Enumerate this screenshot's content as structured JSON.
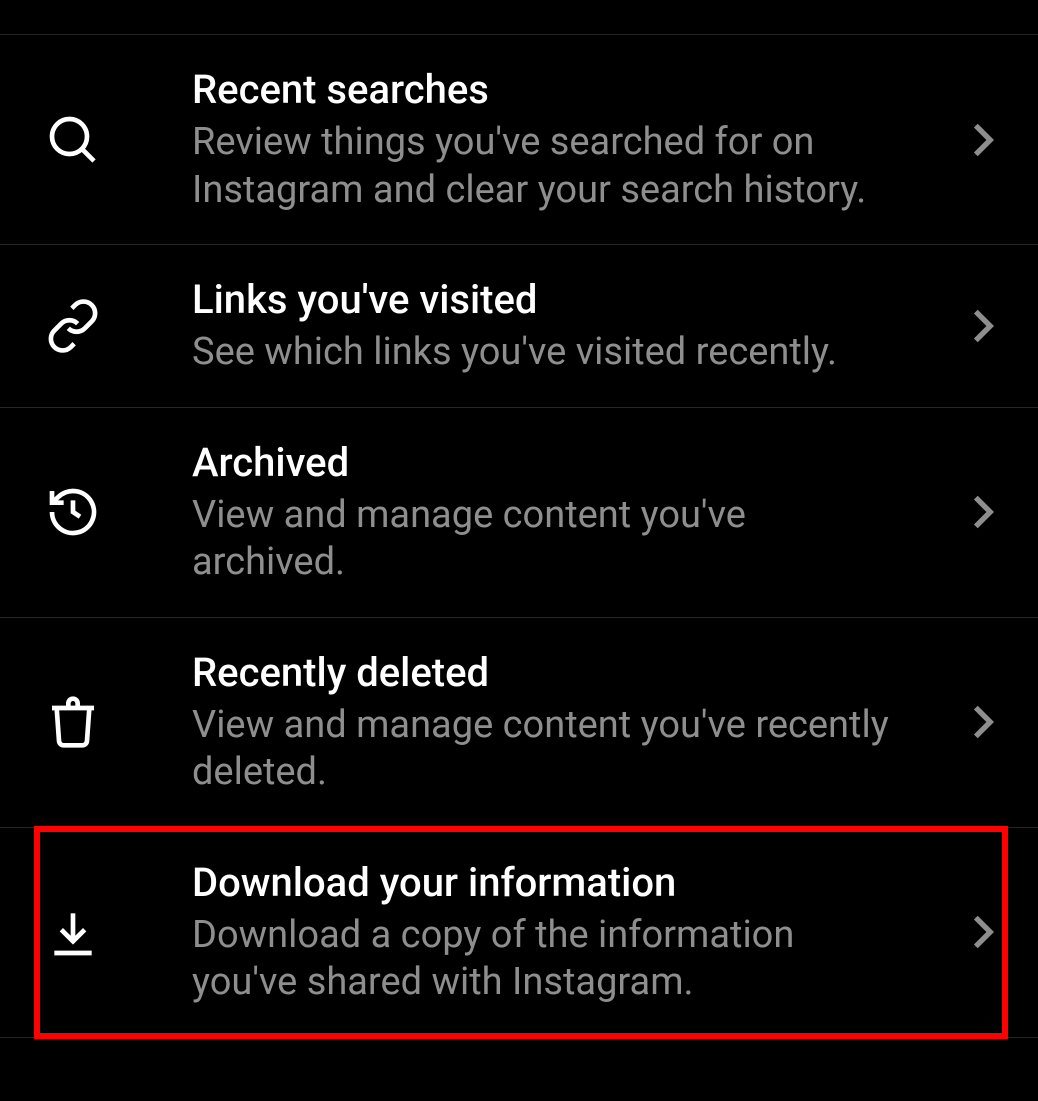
{
  "items": [
    {
      "title": "Recent searches",
      "subtitle": "Review things you've searched for on Instagram and clear your search history."
    },
    {
      "title": "Links you've visited",
      "subtitle": "See which links you've visited recently."
    },
    {
      "title": "Archived",
      "subtitle": "View and manage content you've archived."
    },
    {
      "title": "Recently deleted",
      "subtitle": "View and manage content you've recently deleted."
    },
    {
      "title": "Download your information",
      "subtitle": "Download a copy of the information you've shared with Instagram."
    }
  ]
}
